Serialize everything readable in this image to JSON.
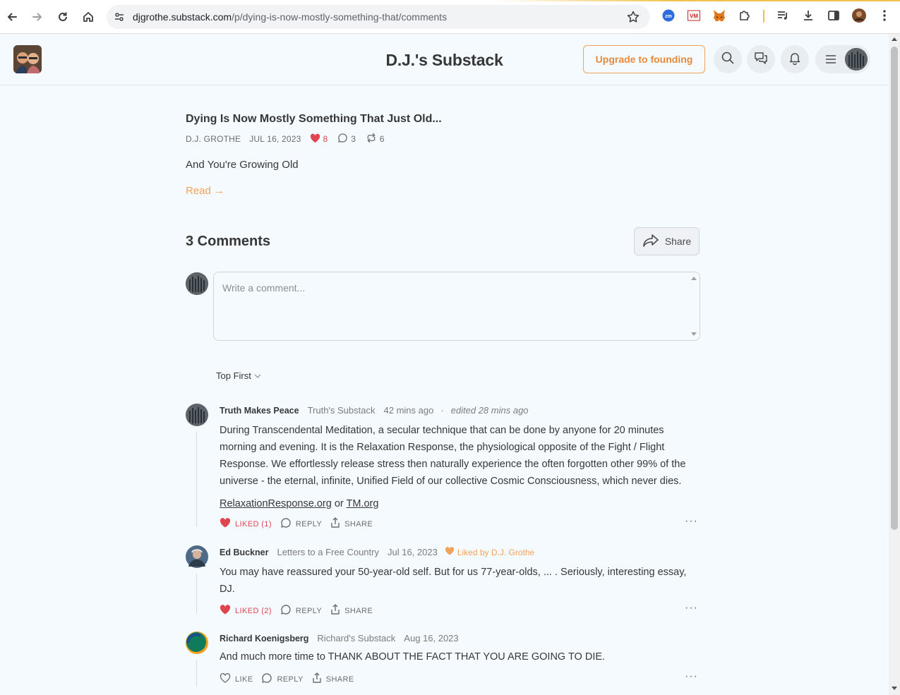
{
  "browser": {
    "url_host": "djgrothe.substack.com",
    "url_path": "/p/dying-is-now-mostly-something-that/comments"
  },
  "header": {
    "title": "D.J.'s Substack",
    "upgrade_label": "Upgrade to founding"
  },
  "post": {
    "title": "Dying Is Now Mostly Something That Just Old...",
    "author": "D.J. GROTHE",
    "date": "JUL 16, 2023",
    "likes": "8",
    "comments": "3",
    "restacks": "6",
    "subtitle": "And You're Growing Old",
    "read_label": "Read →"
  },
  "comments_section": {
    "title": "3 Comments",
    "share_label": "Share",
    "placeholder": "Write a comment...",
    "sort_label": "Top First"
  },
  "comments": [
    {
      "author": "Truth Makes Peace",
      "publication": "Truth's Substack",
      "time": "42 mins ago",
      "separator": "·",
      "edited": "edited 28 mins ago",
      "body": "During Transcendental Meditation, a secular technique that can be done by anyone for 20 minutes morning and evening. It is the Relaxation Response, the physiological opposite of the Fight / Flight Response. We effortlessly release stress then naturally experience the often forgotten other 99% of the universe - the eternal, infinite, Unified Field of our collective Cosmic Consciousness, which never dies.",
      "link1": "RelaxationResponse.org",
      "link_joiner": "or",
      "link2": "TM.org",
      "like_label": "LIKED (1)",
      "reply_label": "REPLY",
      "share_label": "SHARE",
      "more": "···"
    },
    {
      "author": "Ed Buckner",
      "publication": "Letters to a Free Country",
      "time": "Jul 16, 2023",
      "liked_by": "Liked by D.J. Grothe",
      "body": "You may have reassured your 50-year-old self. But for us 77-year-olds, ... . Seriously, interesting essay, DJ.",
      "like_label": "LIKED (2)",
      "reply_label": "REPLY",
      "share_label": "SHARE",
      "more": "···"
    },
    {
      "author": "Richard Koenigsberg",
      "publication": "Richard's Substack",
      "time": "Aug 16, 2023",
      "body": "And much more time to THANK ABOUT THE FACT THAT YOU ARE GOING TO DIE.",
      "like_label": "LIKE",
      "reply_label": "REPLY",
      "share_label": "SHARE",
      "more": "···"
    }
  ],
  "colors": {
    "accent": "#f2a35b",
    "like_red": "#e0454f",
    "text": "#363737",
    "background": "#f5faff"
  },
  "icons": [
    "back-icon",
    "forward-icon",
    "reload-icon",
    "home-icon",
    "site-settings-icon",
    "bookmark-star-icon",
    "zoom-extension-icon",
    "vm-extension-icon",
    "fox-extension-icon",
    "extensions-puzzle-icon",
    "media-icon",
    "download-icon",
    "sidepanel-icon",
    "profile-icon",
    "kebab-menu-icon",
    "search-icon",
    "chat-icon",
    "bell-icon",
    "hamburger-icon",
    "heart-icon",
    "comment-icon",
    "restack-icon",
    "share-arrow-icon",
    "chevron-down-icon",
    "reply-icon",
    "share-icon"
  ]
}
